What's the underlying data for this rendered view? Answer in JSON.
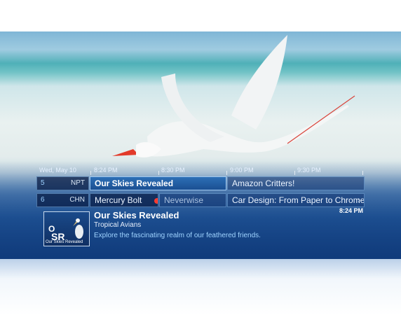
{
  "guide": {
    "date": "Wed, May 10",
    "times": [
      "8:24 PM",
      "8:30 PM",
      "9:00 PM",
      "9:30 PM"
    ],
    "rows": [
      {
        "number": "5",
        "callsign": "NPT",
        "programs": [
          "Our Skies Revealed",
          "Amazon Critters!"
        ]
      },
      {
        "number": "6",
        "callsign": "CHN",
        "programs": [
          "Mercury Bolt",
          "Neverwise",
          "Car Design: From Paper to Chrome"
        ]
      }
    ]
  },
  "info": {
    "title": "Our Skies Revealed",
    "episode": "Tropical Avians",
    "description": "Explore the fascinating realm of our feathered friends.",
    "clock": "8:24 PM",
    "thumbnail": {
      "logo_top": "O",
      "logo_bottom": "SR",
      "caption": "Our Skies Revealed"
    }
  },
  "colors": {
    "selected": "#2d6fb6",
    "record": "#ff3b30",
    "description": "#9fd3ff"
  },
  "icons": [
    "record-dot-icon",
    "chevron-right-icon"
  ]
}
